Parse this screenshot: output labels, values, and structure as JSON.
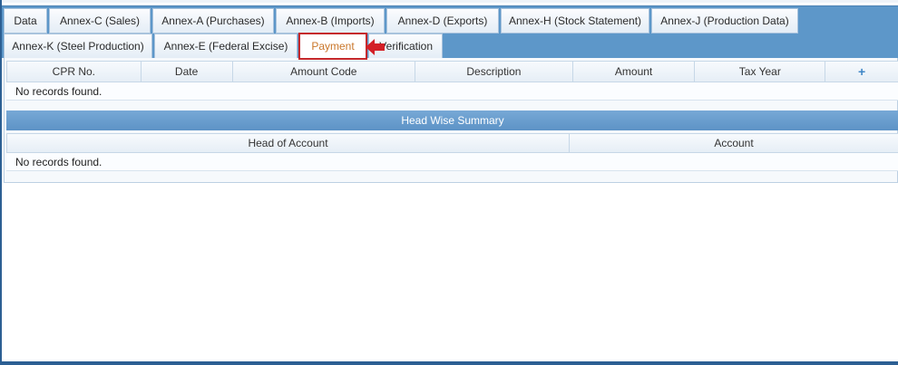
{
  "tabs": [
    {
      "label": "Data"
    },
    {
      "label": "Annex-C (Sales)"
    },
    {
      "label": "Annex-A (Purchases)"
    },
    {
      "label": "Annex-B (Imports)"
    },
    {
      "label": "Annex-D (Exports)"
    },
    {
      "label": "Annex-H (Stock Statement)"
    },
    {
      "label": "Annex-J (Production Data)"
    },
    {
      "label": "Annex-K (Steel Production)"
    },
    {
      "label": "Annex-E (Federal Excise)"
    },
    {
      "label": "Payment",
      "active": true
    },
    {
      "label": "Verification"
    }
  ],
  "payments_grid": {
    "columns": [
      "CPR No.",
      "Date",
      "Amount Code",
      "Description",
      "Amount",
      "Tax Year"
    ],
    "add_icon": "plus-icon",
    "empty_text": "No records found."
  },
  "head_wise_summary": {
    "title": "Head Wise Summary",
    "columns": [
      "Head of Account",
      "Account"
    ],
    "empty_text": "No records found."
  },
  "colors": {
    "tabbar": "#5d97c9",
    "active_tab_text": "#c9762a",
    "highlight": "#c5282b",
    "frame": "#2c5f93"
  }
}
